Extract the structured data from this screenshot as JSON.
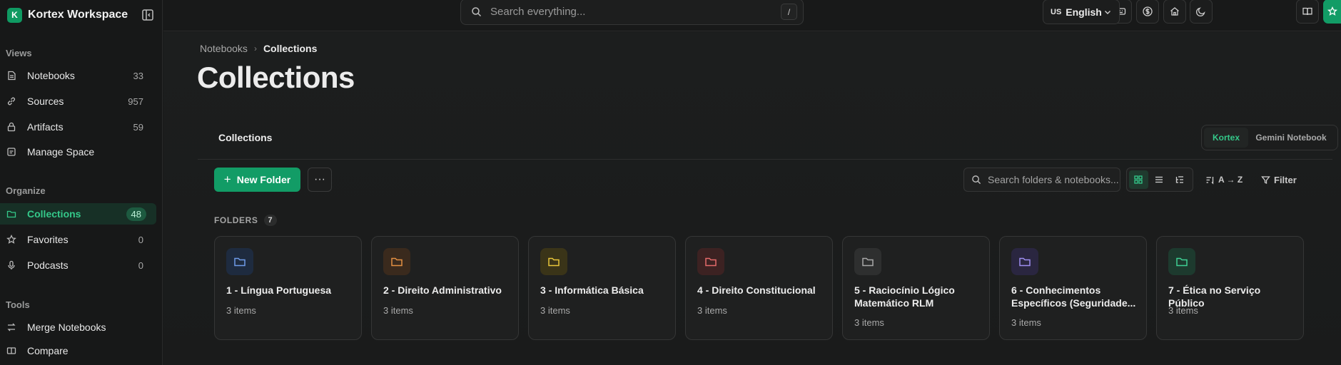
{
  "brand": {
    "logo_letter": "K",
    "name": "Kortex Workspace"
  },
  "sidebar": {
    "sections": [
      {
        "label": "Views",
        "items": [
          {
            "label": "Notebooks",
            "count": "33",
            "icon": "notebook-icon"
          },
          {
            "label": "Sources",
            "count": "957",
            "icon": "link-icon"
          },
          {
            "label": "Artifacts",
            "count": "59",
            "icon": "lock-icon"
          },
          {
            "label": "Manage Space",
            "count": "",
            "icon": "storage-icon"
          }
        ]
      },
      {
        "label": "Organize",
        "items": [
          {
            "label": "Collections",
            "count": "48",
            "icon": "folder-icon",
            "active": true
          },
          {
            "label": "Favorites",
            "count": "0",
            "icon": "star-icon"
          },
          {
            "label": "Podcasts",
            "count": "0",
            "icon": "microphone-icon"
          }
        ]
      },
      {
        "label": "Tools",
        "items": [
          {
            "label": "Merge Notebooks",
            "count": "",
            "icon": "merge-icon"
          },
          {
            "label": "Compare",
            "count": "",
            "icon": "compare-icon"
          }
        ]
      }
    ]
  },
  "topbar": {
    "search_placeholder": "Search everything...",
    "shortcut": "/",
    "language": {
      "flag": "US",
      "label": "English"
    }
  },
  "breadcrumb": {
    "parent": "Notebooks",
    "separator": "›",
    "current": "Collections"
  },
  "page_title": "Collections",
  "subheader": {
    "title": "Collections",
    "tabs": [
      {
        "label": "Kortex",
        "active": true
      },
      {
        "label": "Gemini Notebook",
        "active": false
      }
    ]
  },
  "toolbar": {
    "new_folder_label": "New Folder",
    "more_label": "···",
    "search_placeholder": "Search folders & notebooks...",
    "sort_label": "A → Z",
    "filter_label": "Filter"
  },
  "folders": {
    "label": "FOLDERS",
    "count": "7",
    "items": [
      {
        "name": "1 - Língua Portuguesa",
        "items": "3 items",
        "color": "#6f9be8",
        "bg": "#1e2b3f"
      },
      {
        "name": "2 - Direito Administrativo",
        "items": "3 items",
        "color": "#e38f43",
        "bg": "#3a2a1d"
      },
      {
        "name": "3 - Informática Básica",
        "items": "3 items",
        "color": "#e8c53a",
        "bg": "#3a3418"
      },
      {
        "name": "4 - Direito Constitucional",
        "items": "3 items",
        "color": "#e46a6a",
        "bg": "#3c2222"
      },
      {
        "name": "5 - Raciocínio Lógico Matemático RLM",
        "items": "3 items",
        "color": "#a8a8a8",
        "bg": "#2e2f2f"
      },
      {
        "name": "6 - Conhecimentos Específicos (Seguridade...",
        "items": "3 items",
        "color": "#9e8ef0",
        "bg": "#2a2640"
      },
      {
        "name": "7 - Ética no Serviço Público",
        "items": "3 items",
        "color": "#3fcf94",
        "bg": "#1d3a2e"
      }
    ]
  }
}
